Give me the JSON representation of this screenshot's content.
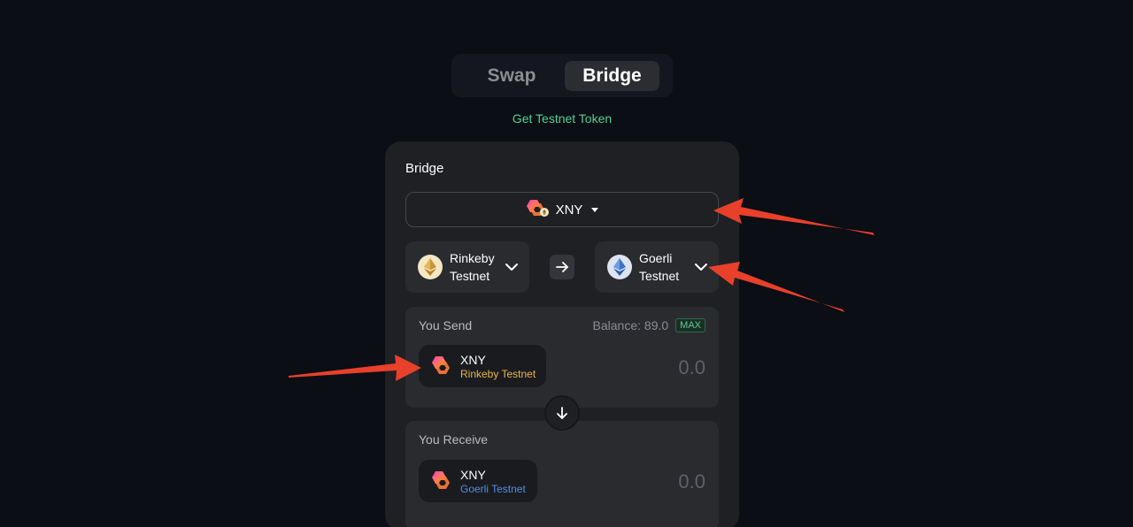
{
  "tabs": {
    "swap_label": "Swap",
    "bridge_label": "Bridge",
    "active": "Bridge"
  },
  "testnet_link": "Get Testnet Token",
  "card": {
    "title": "Bridge",
    "token_select": {
      "symbol": "XNY",
      "icon": "xny-token-icon"
    },
    "from_network": {
      "line1": "Rinkeby",
      "line2": "Testnet",
      "icon": "ethereum-gold-icon"
    },
    "to_network": {
      "line1": "Goerli",
      "line2": "Testnet",
      "icon": "ethereum-blue-icon"
    },
    "send": {
      "label": "You Send",
      "balance": "Balance: 89.0",
      "max_label": "MAX",
      "token": "XNY",
      "network": "Rinkeby Testnet",
      "amount": "0.0"
    },
    "receive": {
      "label": "You Receive",
      "token": "XNY",
      "network": "Goerli Testnet",
      "amount": "0.0"
    }
  },
  "colors": {
    "background": "#0b0e15",
    "card": "#1f2024",
    "accent_green": "#55cf91",
    "rinkeby_gold": "#e9b64c",
    "goerli_blue": "#4f8fe6",
    "annotation_red": "#e8402a"
  }
}
